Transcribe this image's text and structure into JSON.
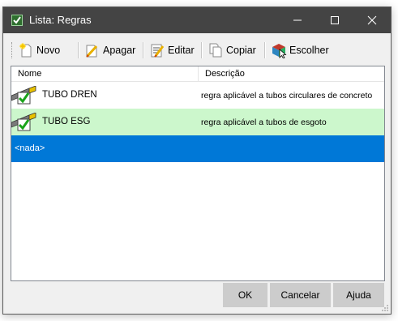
{
  "window": {
    "title": "Lista: Regras"
  },
  "toolbar": {
    "novo_label": "Novo",
    "apagar_label": "Apagar",
    "editar_label": "Editar",
    "copiar_label": "Copiar",
    "escolher_label": "Escolher"
  },
  "list": {
    "columns": [
      "Nome",
      "Descrição"
    ],
    "rows": [
      {
        "icon": "pipe-rule-icon",
        "name": "TUBO DREN",
        "description": "regra aplicável a tubos circulares de concreto",
        "highlight": "none"
      },
      {
        "icon": "pipe-rule-icon",
        "name": "TUBO ESG",
        "description": "regra aplicável a tubos de esgoto",
        "highlight": "#ccf7cc"
      }
    ],
    "selected_item": "<nada>"
  },
  "buttons": {
    "ok": "OK",
    "cancelar": "Cancelar",
    "ajuda": "Ajuda"
  },
  "colors": {
    "titlebar": "#444444",
    "selection": "#0078d7",
    "row_highlight": "#ccf7cc",
    "button": "#cccccc"
  }
}
